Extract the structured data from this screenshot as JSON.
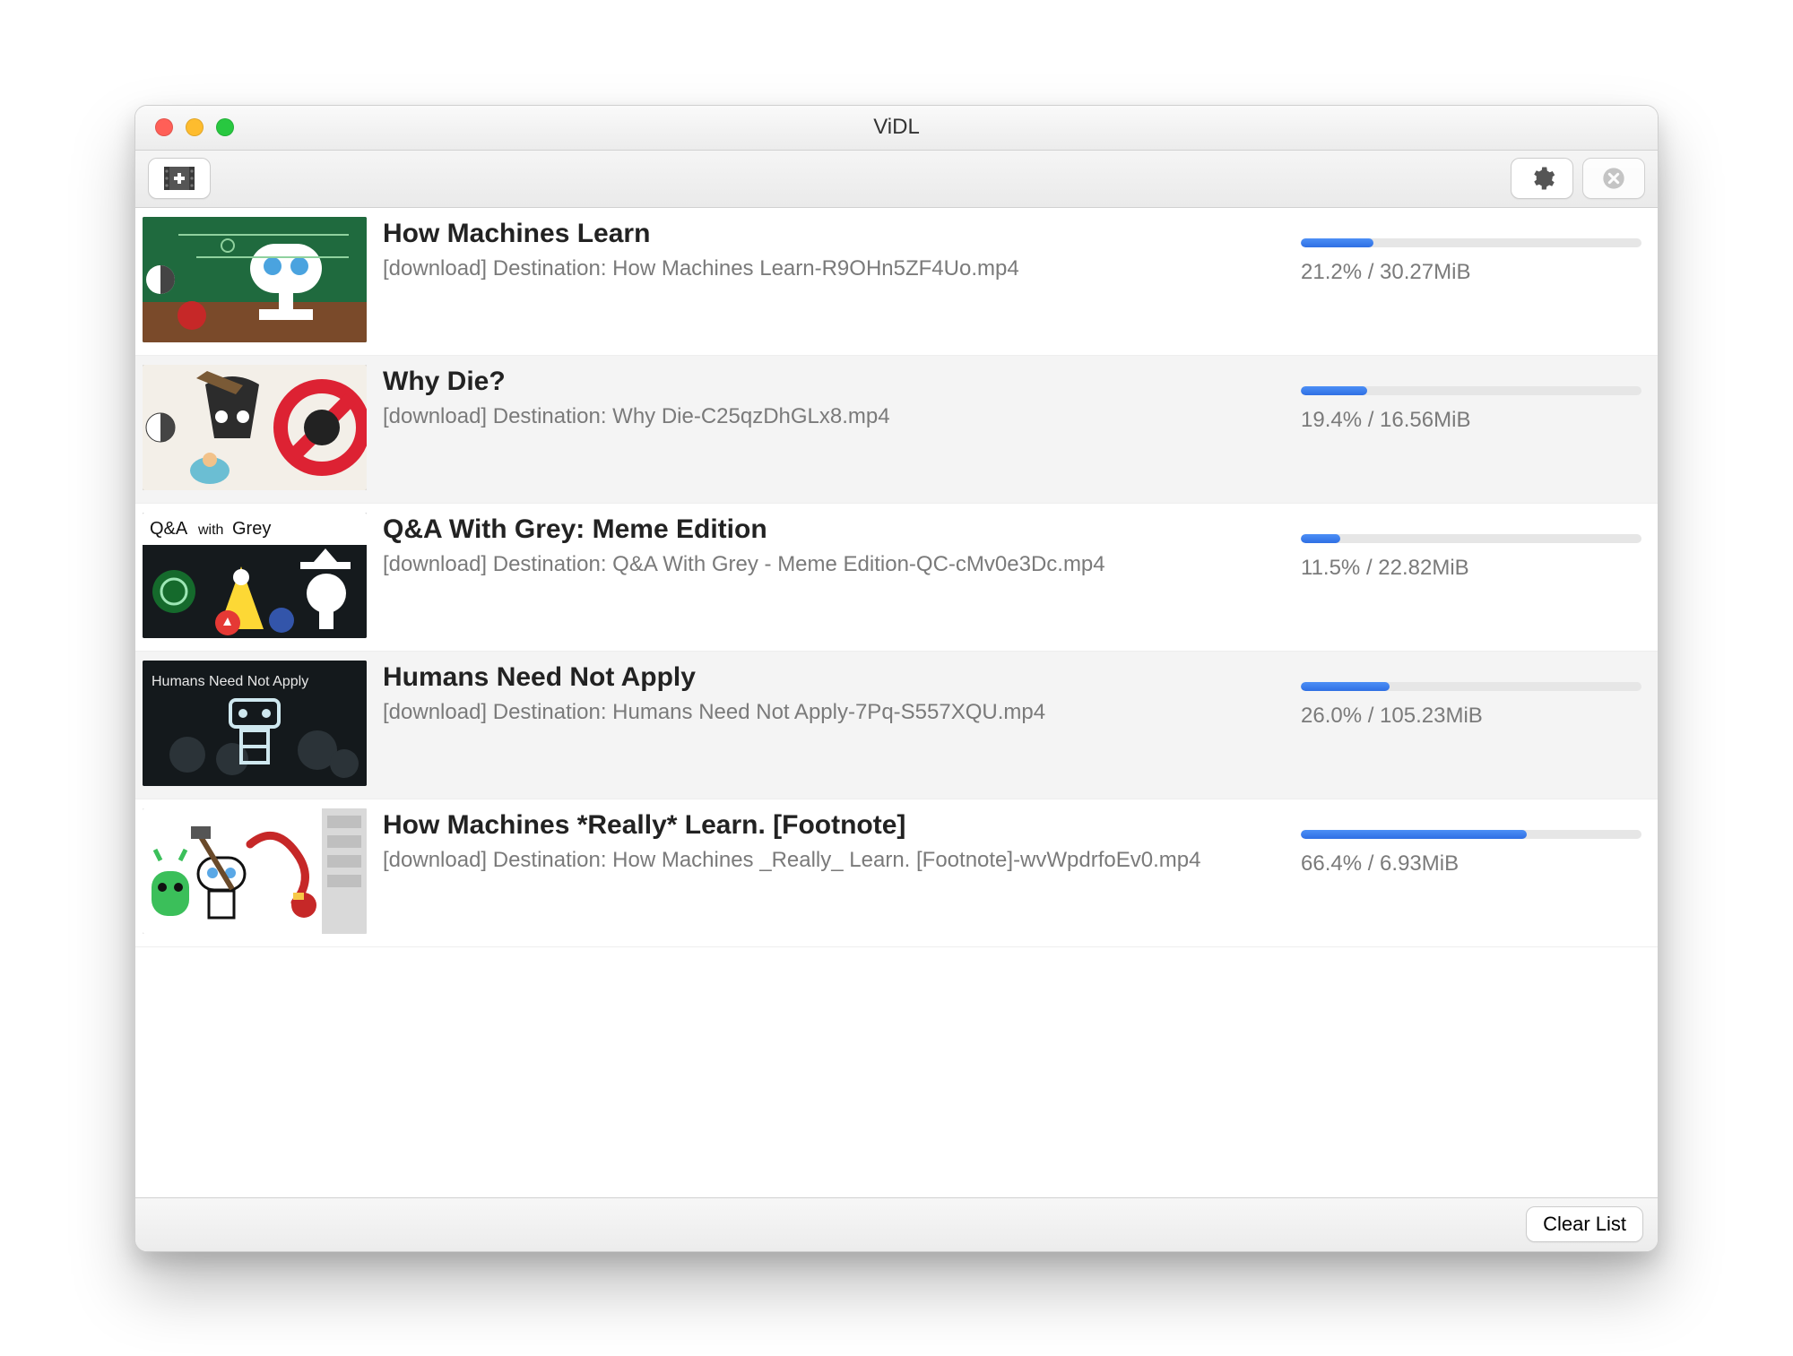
{
  "window": {
    "title": "ViDL"
  },
  "toolbar": {
    "add_label": "Add video",
    "settings_label": "Preferences",
    "cancel_all_label": "Cancel all"
  },
  "footer": {
    "clear_label": "Clear List"
  },
  "downloads": [
    {
      "title": "How Machines Learn",
      "status": "[download] Destination: How Machines Learn-R9OHn5ZF4Uo.mp4",
      "progress_pct": 21.2,
      "percent_text": "21.2% / 30.27MiB"
    },
    {
      "title": "Why Die?",
      "status": "[download] Destination: Why Die-C25qzDhGLx8.mp4",
      "progress_pct": 19.4,
      "percent_text": "19.4% / 16.56MiB"
    },
    {
      "title": "Q&A With Grey: Meme Edition",
      "status": "[download] Destination: Q&A With Grey - Meme Edition-QC-cMv0e3Dc.mp4",
      "progress_pct": 11.5,
      "percent_text": "11.5% / 22.82MiB"
    },
    {
      "title": "Humans Need Not Apply",
      "status": "[download] Destination: Humans Need Not Apply-7Pq-S557XQU.mp4",
      "progress_pct": 26.0,
      "percent_text": "26.0% / 105.23MiB"
    },
    {
      "title": "How Machines *Really* Learn.  [Footnote]",
      "status": "[download] Destination: How Machines _Really_ Learn.  [Footnote]-wvWpdrfoEv0.mp4",
      "progress_pct": 66.4,
      "percent_text": "66.4% / 6.93MiB"
    }
  ]
}
